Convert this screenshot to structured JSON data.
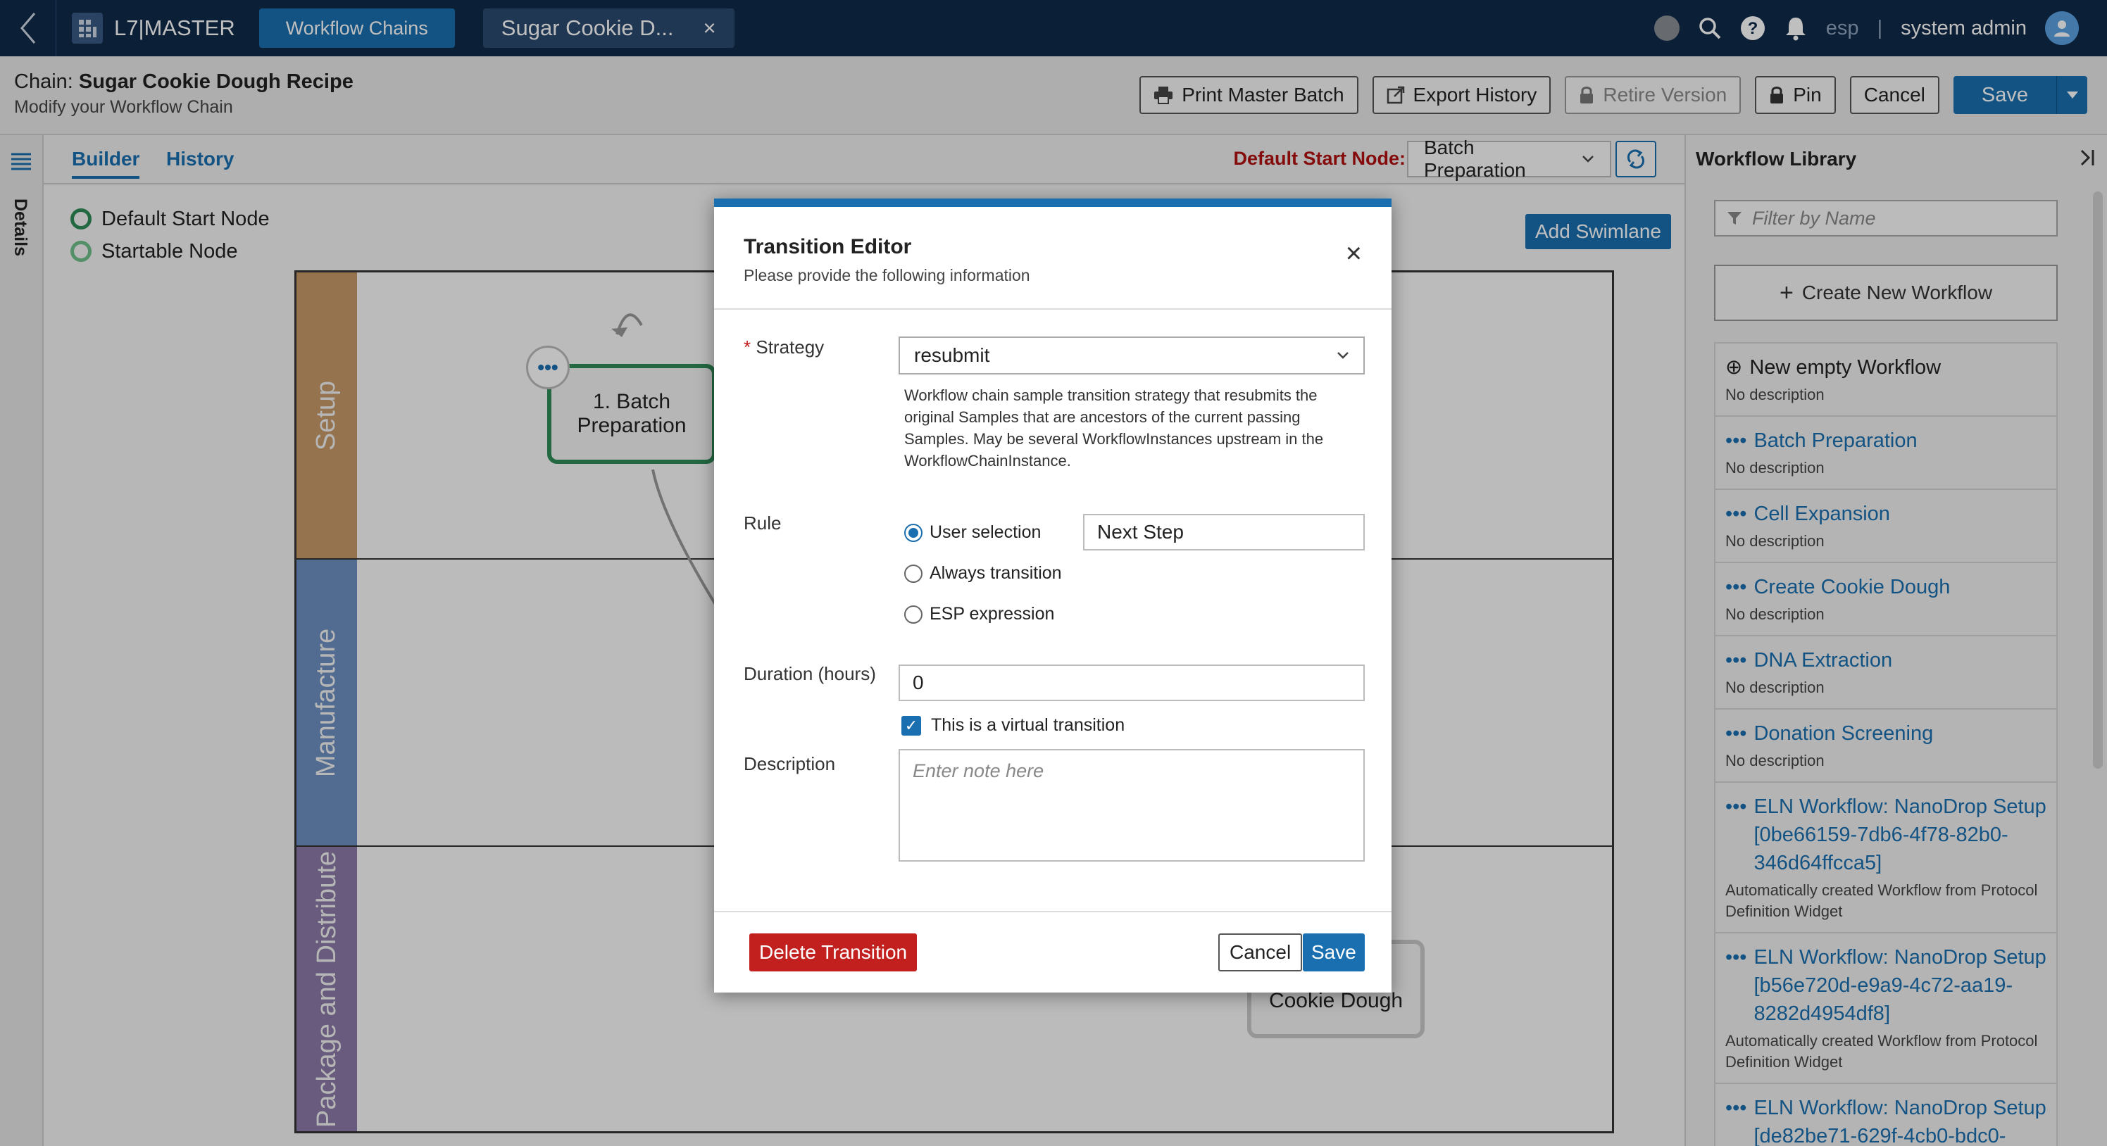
{
  "topbar": {
    "logo": "L7|MASTER",
    "nav_tab": "Workflow Chains",
    "doc_tab": "Sugar Cookie D...",
    "doc_tab_close": "×",
    "app_name": "esp",
    "separator": "|",
    "user": "system admin"
  },
  "header": {
    "chain_prefix": "Chain:",
    "chain_name": "Sugar Cookie Dough Recipe",
    "subtitle": "Modify your Workflow Chain",
    "buttons": {
      "print": "Print Master Batch",
      "export": "Export History",
      "retire": "Retire Version",
      "pin": "Pin",
      "cancel": "Cancel",
      "save": "Save"
    }
  },
  "left_rail": {
    "details": "Details"
  },
  "builder": {
    "tabs": [
      "Builder",
      "History"
    ],
    "start_node_label": "Default Start Node:",
    "start_node_value": "Batch Preparation",
    "legend": [
      "Default Start Node",
      "Startable Node"
    ],
    "add_swimlane": "Add Swimlane",
    "lanes": [
      {
        "name": "Setup",
        "color": "#c89a6a"
      },
      {
        "name": "Manufacture",
        "color": "#6d8fc2"
      },
      {
        "name": "Package and Distribute",
        "color": "#8b7aa8"
      }
    ],
    "node_menu": "•••",
    "node_1": "1. Batch Preparation",
    "node_ghost": "Cookie Dough"
  },
  "library": {
    "title": "Workflow Library",
    "filter_placeholder": "Filter by Name",
    "create": "Create New Workflow",
    "items": [
      {
        "title": "New empty Workflow",
        "desc": "No description"
      },
      {
        "title": "Batch Preparation",
        "desc": "No description"
      },
      {
        "title": "Cell Expansion",
        "desc": "No description"
      },
      {
        "title": "Create Cookie Dough",
        "desc": "No description"
      },
      {
        "title": "DNA Extraction",
        "desc": "No description"
      },
      {
        "title": "Donation Screening",
        "desc": "No description"
      },
      {
        "title": "ELN Workflow: NanoDrop Setup [0be66159-7db6-4f78-82b0-346d64ffcca5]",
        "desc": "Automatically created Workflow from Protocol Definition Widget"
      },
      {
        "title": "ELN Workflow: NanoDrop Setup [b56e720d-e9a9-4c72-aa19-8282d4954df8]",
        "desc": "Automatically created Workflow from Protocol Definition Widget"
      },
      {
        "title": "ELN Workflow: NanoDrop Setup [de82be71-629f-4cb0-bdc0-",
        "desc": ""
      }
    ]
  },
  "modal": {
    "title": "Transition Editor",
    "subtitle": "Please provide the following information",
    "close": "×",
    "strategy_label": "Strategy",
    "required_mark": "*",
    "strategy_value": "resubmit",
    "strategy_help": "Workflow chain sample transition strategy that resubmits the original Samples that are ancestors of the current passing Samples. May be several WorkflowInstances upstream in the WorkflowChainInstance.",
    "rule_label": "Rule",
    "rule_options": [
      "User selection",
      "Always transition",
      "ESP expression"
    ],
    "rule_selected": "User selection",
    "next_step_value": "Next Step",
    "duration_label": "Duration (hours)",
    "duration_value": "0",
    "virtual_label": "This is a virtual transition",
    "virtual_checked": true,
    "description_label": "Description",
    "description_placeholder": "Enter note here",
    "delete": "Delete Transition",
    "cancel": "Cancel",
    "save": "Save"
  }
}
